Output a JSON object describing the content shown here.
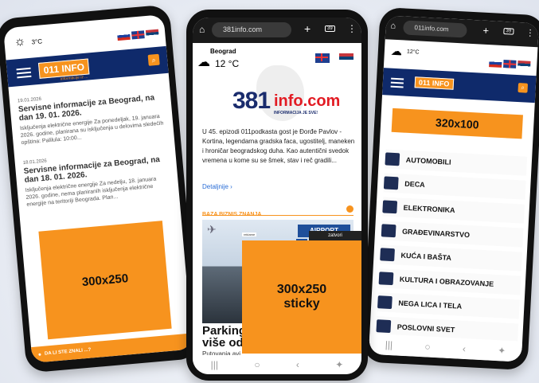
{
  "left_phone": {
    "weather_temp": "3°C",
    "logo_text": "011 INFO",
    "logo_sub": "informacije iz ...",
    "articles": [
      {
        "date": "19.01.2026",
        "title": "Servisne informacije za Beograd, na dan 19. 01. 2026.",
        "text": "Isključenja električne energije Za ponedeljak, 19. januara 2026. godine, planirana su isključenja u delovima sledećih opština: Palilula: 10:00..."
      },
      {
        "date": "18.01.2026",
        "title": "Servisne informacije za Beograd, na dan 18. 01. 2026.",
        "text": "Isključenja električne energije Za nedelju, 18. januara 2026. godine, nema planiranih isključenja električne energije na teritoriji Beograda. Plan..."
      }
    ],
    "ad_label": "300x250",
    "footer_link": "DA LI STE ZNALI ...?"
  },
  "center_phone": {
    "url": "381info.com",
    "tab_count": "39",
    "city": "Beograd",
    "temp": "12 °C",
    "logo_main": "381",
    "logo_domain": "info.com",
    "logo_tagline": "INFORMACIJA JE SVE!",
    "intro_text": "U 45. epizodi 011podkasta gost je Đorđe Pavlov - Kortina, legendarna gradska faca, ugostitelj, maneken i hroničar beogradskog duha. Kao autentični svedok vremena u kome su se šmek, stav i reč gradili...",
    "details_link": "Detaljnije ›",
    "section_title": "BAZA BIZNIS ZNANJA",
    "airport_sign": "AIRPORT",
    "parking_sign": "P",
    "headline_part1": "Parking",
    "headline_part2": "više od",
    "caption": "Putovanja avi",
    "sticky_close": "zatvori",
    "sticky_small_label": "reklame",
    "sticky_ad_line1": "300x250",
    "sticky_ad_line2": "sticky"
  },
  "right_phone": {
    "url": "011info.com",
    "tab_count": "39",
    "temp": "12°C",
    "logo_text": "011 INFO",
    "ad_label": "320x100",
    "categories": [
      "AUTOMOBILI",
      "DECA",
      "ELEKTRONIKA",
      "GRAĐEVINARSTVO",
      "KUĆA I BAŠTA",
      "KULTURA I OBRAZOVANJE",
      "NEGA LICA I TELA",
      "POSLOVNI SVET"
    ]
  },
  "colors": {
    "accent": "#f7931e",
    "navy": "#0f2a6b",
    "brand_red": "#e21b23"
  }
}
